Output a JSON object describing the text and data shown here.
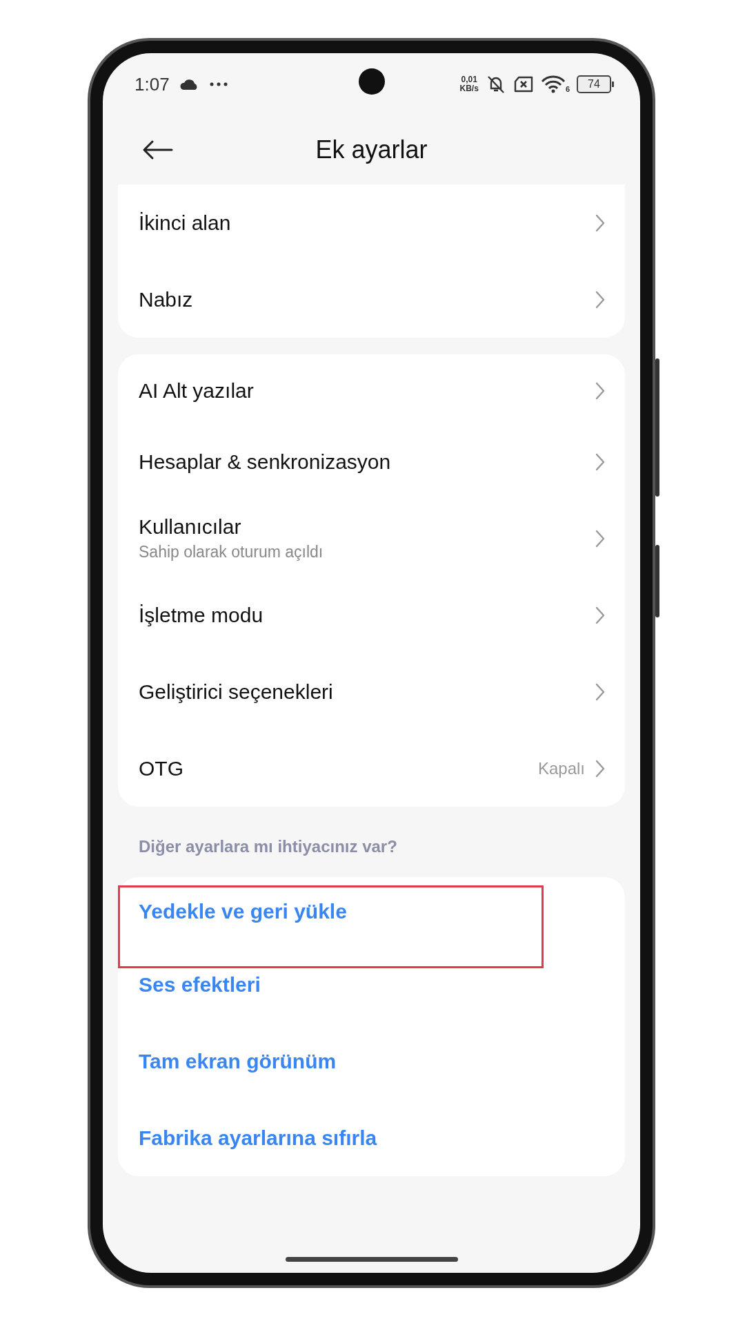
{
  "status_bar": {
    "time": "1:07",
    "speed_value": "0,01",
    "speed_unit": "KB/s",
    "wifi_label": "6",
    "battery": "74"
  },
  "header": {
    "title": "Ek ayarlar"
  },
  "groups": [
    {
      "items": [
        {
          "label": "İkinci alan"
        },
        {
          "label": "Nabız"
        }
      ]
    },
    {
      "items": [
        {
          "label": "AI Alt yazılar"
        },
        {
          "label": "Hesaplar & senkronizasyon"
        },
        {
          "label": "Kullanıcılar",
          "subtitle": "Sahip olarak oturum açıldı"
        },
        {
          "label": "İşletme modu"
        },
        {
          "label": "Geliştirici seçenekleri"
        },
        {
          "label": "OTG",
          "value": "Kapalı"
        }
      ]
    }
  ],
  "more_section": {
    "heading": "Diğer ayarlara mı ihtiyacınız var?",
    "links": [
      {
        "label": "Yedekle ve geri yükle",
        "highlighted": true
      },
      {
        "label": "Ses efektleri",
        "highlighted": false
      },
      {
        "label": "Tam ekran görünüm",
        "highlighted": false
      },
      {
        "label": "Fabrika ayarlarına sıfırla",
        "highlighted": false
      }
    ]
  }
}
